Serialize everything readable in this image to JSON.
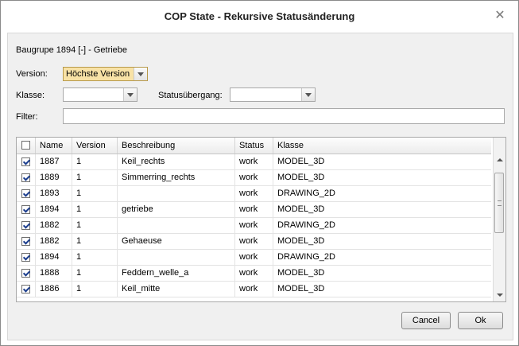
{
  "window": {
    "title": "COP State - Rekursive Statusänderung"
  },
  "subtitle": "Baugrupe 1894 [-] - Getriebe",
  "form": {
    "version_label": "Version:",
    "version_value": "Höchste Version",
    "klasse_label": "Klasse:",
    "klasse_value": "",
    "statusuebergang_label": "Statusübergang:",
    "statusuebergang_value": "",
    "filter_label": "Filter:",
    "filter_value": ""
  },
  "table": {
    "columns": [
      "Name",
      "Version",
      "Beschreibung",
      "Status",
      "Klasse"
    ],
    "header_checked": false,
    "rows": [
      {
        "checked": true,
        "cells": [
          "1887",
          "1",
          "Keil_rechts",
          "work",
          "MODEL_3D"
        ]
      },
      {
        "checked": true,
        "cells": [
          "1889",
          "1",
          "Simmerring_rechts",
          "work",
          "MODEL_3D"
        ]
      },
      {
        "checked": true,
        "cells": [
          "1893",
          "1",
          "",
          "work",
          "DRAWING_2D"
        ]
      },
      {
        "checked": true,
        "cells": [
          "1894",
          "1",
          "getriebe",
          "work",
          "MODEL_3D"
        ]
      },
      {
        "checked": true,
        "cells": [
          "1882",
          "1",
          "",
          "work",
          "DRAWING_2D"
        ]
      },
      {
        "checked": true,
        "cells": [
          "1882",
          "1",
          "Gehaeuse",
          "work",
          "MODEL_3D"
        ]
      },
      {
        "checked": true,
        "cells": [
          "1894",
          "1",
          "",
          "work",
          "DRAWING_2D"
        ]
      },
      {
        "checked": true,
        "cells": [
          "1888",
          "1",
          "Feddern_welle_a",
          "work",
          "MODEL_3D"
        ]
      },
      {
        "checked": true,
        "cells": [
          "1886",
          "1",
          "Keil_mitte",
          "work",
          "MODEL_3D"
        ]
      }
    ]
  },
  "buttons": {
    "cancel": "Cancel",
    "ok": "Ok"
  },
  "icons": {
    "close": "close-icon"
  },
  "colors": {
    "version_highlight": "#f8e2a6"
  }
}
